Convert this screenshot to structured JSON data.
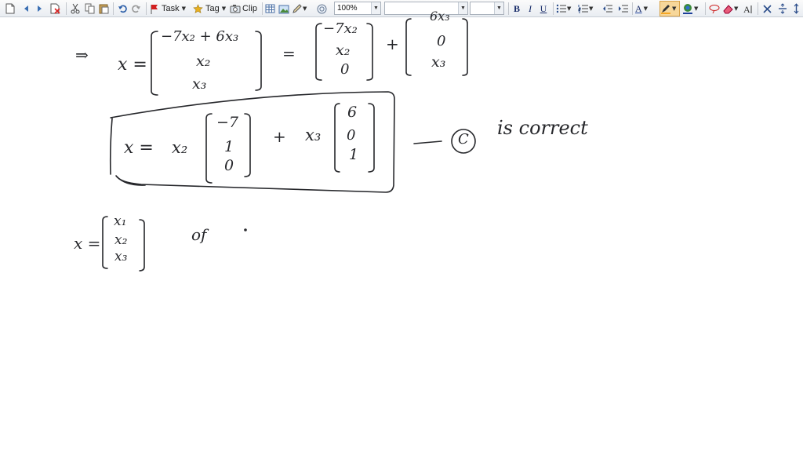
{
  "toolbar": {
    "task_label": "Task",
    "tag_label": "Tag",
    "clip_label": "Clip",
    "zoom_value": "100%",
    "bold": "B",
    "italic": "I",
    "underline": "U",
    "font_size_label": "A",
    "accent_color": "#f0a030",
    "flag_color": "#d32020",
    "tag_color": "#e8b020",
    "highlight_color": "#f5a623",
    "font_color": "#1c3f9a"
  },
  "note": {
    "row1": {
      "implies": "⇒",
      "lhs": "x =",
      "m1": [
        "−7x₂ + 6x₃",
        "x₂",
        "x₃"
      ],
      "equals": "=",
      "m2": [
        "−7x₂",
        "x₂",
        "0"
      ],
      "plus": "+",
      "m3": [
        "6x₃",
        "0",
        "x₃"
      ]
    },
    "row2": {
      "lhs": "x =",
      "coef1": "x₂",
      "v1": [
        "−7",
        "1",
        "0"
      ],
      "plus": "+",
      "coef2": "x₃",
      "v2": [
        "6",
        "0",
        "1"
      ],
      "dash": "—",
      "choice": "C",
      "comment": "is correct"
    },
    "row3": {
      "lhs": "x =",
      "m": [
        "x₁",
        "x₂",
        "x₃"
      ],
      "of": "of",
      "dot": "·"
    }
  }
}
